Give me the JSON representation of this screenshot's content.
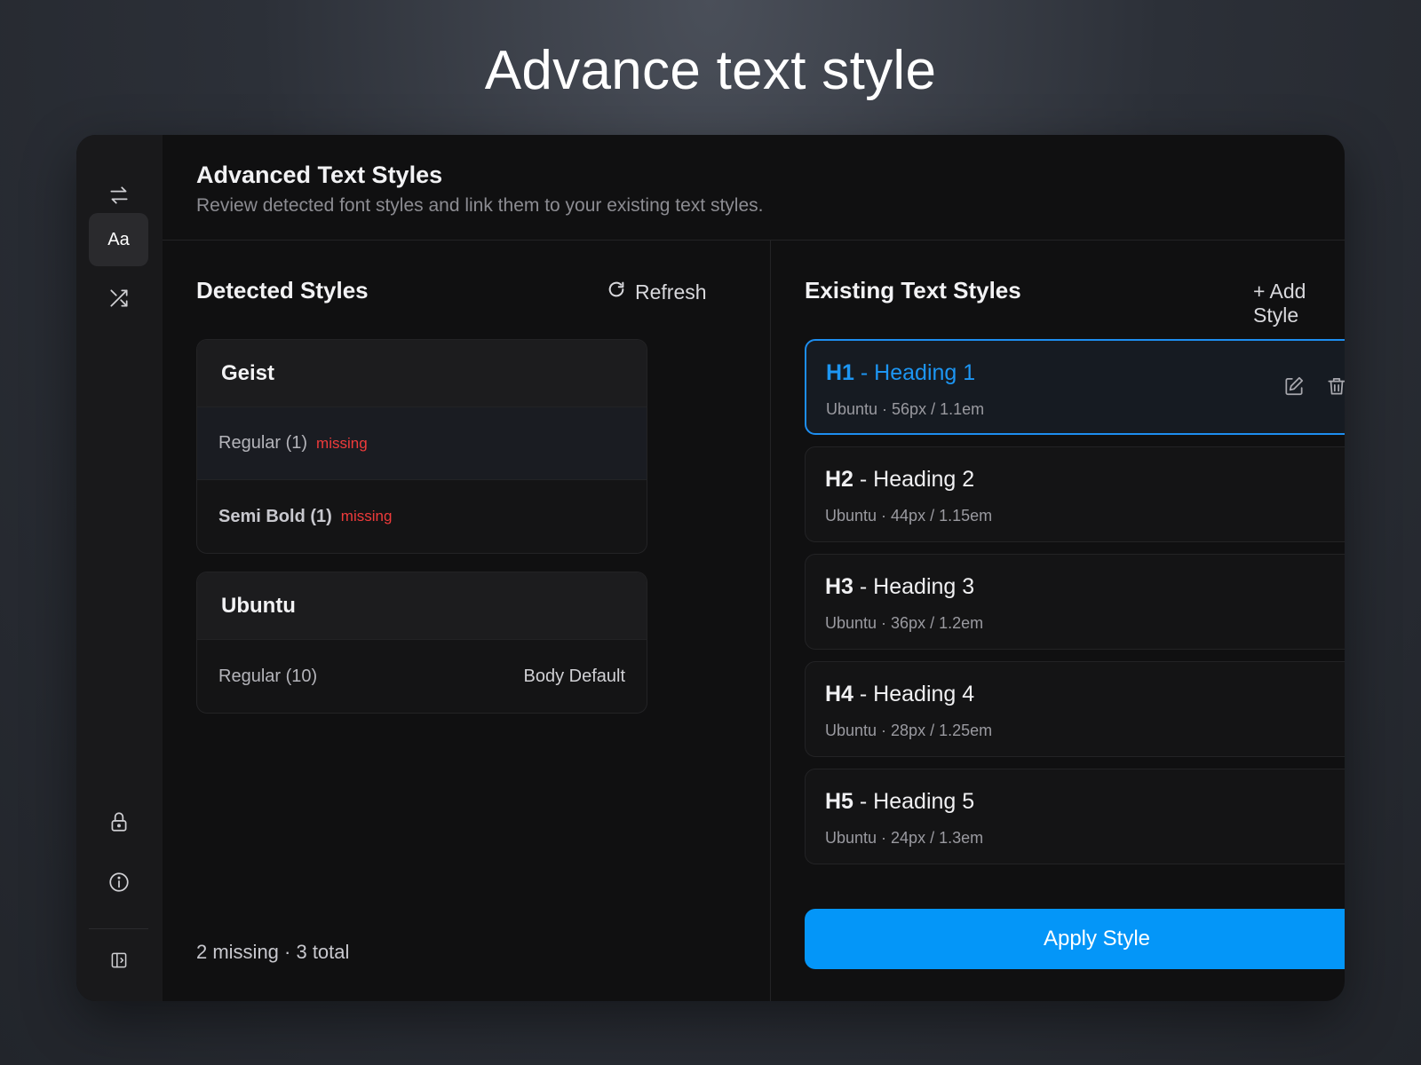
{
  "headline": "Advance text style",
  "header": {
    "title": "Advanced Text Styles",
    "subtitle": "Review detected font styles and link them to your existing text styles."
  },
  "rail": {
    "aa_label": "Aa",
    "icons": [
      "swap-icon",
      "text-styles-icon",
      "shuffle-icon",
      "lock-icon",
      "info-icon",
      "sidebar-toggle-icon"
    ]
  },
  "detected": {
    "title": "Detected Styles",
    "refresh_label": "Refresh",
    "fonts": [
      {
        "name": "Geist",
        "rows": [
          {
            "label": "Regular (1)",
            "badge": "missing"
          },
          {
            "label": "Semi Bold (1)",
            "badge": "missing"
          }
        ]
      },
      {
        "name": "Ubuntu",
        "rows": [
          {
            "label": "Regular (10)",
            "link": "Body Default"
          }
        ]
      }
    ],
    "footer": "2 missing · 3 total"
  },
  "existing": {
    "title": "Existing Text Styles",
    "add_label": "+ Add Style",
    "styles": [
      {
        "tag": "H1",
        "name": " - Heading 1",
        "meta": "Ubuntu · 56px / 1.1em"
      },
      {
        "tag": "H2",
        "name": " - Heading 2",
        "meta": "Ubuntu · 44px / 1.15em"
      },
      {
        "tag": "H3",
        "name": " - Heading 3",
        "meta": "Ubuntu · 36px / 1.2em"
      },
      {
        "tag": "H4",
        "name": " - Heading 4",
        "meta": "Ubuntu · 28px / 1.25em"
      },
      {
        "tag": "H5",
        "name": " - Heading 5",
        "meta": "Ubuntu · 24px / 1.3em"
      }
    ],
    "apply_label": "Apply Style"
  },
  "colors": {
    "accent": "#0496f8",
    "selected_border": "#1d8ef0",
    "missing": "#ef3b3b"
  }
}
